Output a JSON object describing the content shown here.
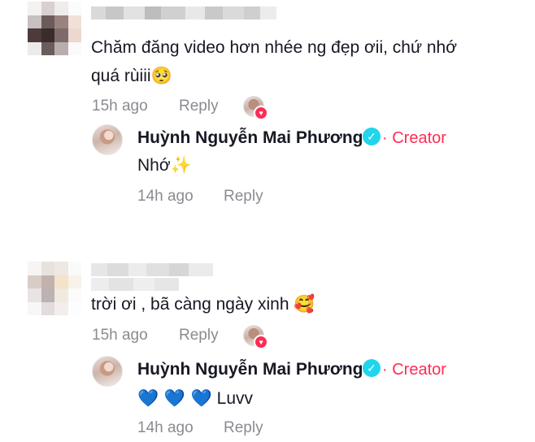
{
  "threads": [
    {
      "comment": {
        "text_line1": "Chăm đăng video hơn nhée ng đẹp ơii, chứ nhớ",
        "text_line2": "quá rùiii",
        "emoji": "🥺",
        "time": "15h ago",
        "reply_label": "Reply"
      },
      "reply": {
        "author": "Huỳnh Nguyễn Mai Phương",
        "badge": "· Creator",
        "text": "Nhớ",
        "emoji": "✨",
        "time": "14h ago",
        "reply_label": "Reply"
      }
    },
    {
      "comment": {
        "text_line1": "trời ơi , bã càng ngày xinh",
        "emoji": "🥰",
        "time": "15h ago",
        "reply_label": "Reply"
      },
      "reply": {
        "author": "Huỳnh Nguyễn Mai Phương",
        "badge": "· Creator",
        "emoji": "💙 💙 💙",
        "text": "Luvv",
        "time": "14h ago",
        "reply_label": "Reply"
      }
    }
  ],
  "icons": {
    "verified": "✓",
    "heart": "♥"
  },
  "colors": {
    "accent": "#fe2c55",
    "verified": "#20d5ec",
    "meta": "#8a8b91"
  }
}
